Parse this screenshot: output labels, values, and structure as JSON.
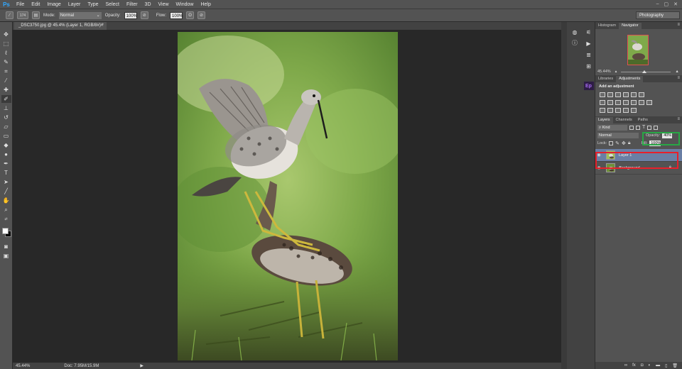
{
  "app": {
    "logo": "Ps",
    "menu": [
      "File",
      "Edit",
      "Image",
      "Layer",
      "Type",
      "Select",
      "Filter",
      "3D",
      "View",
      "Window",
      "Help"
    ],
    "window_controls": [
      "–",
      "▢",
      "✕"
    ]
  },
  "options": {
    "brush_size": "174",
    "mode_label": "Mode:",
    "mode_value": "Normal",
    "opacity_label": "Opacity:",
    "opacity_value": "100%",
    "flow_label": "Flow:",
    "flow_value": "100%",
    "workspace": "Photography"
  },
  "document": {
    "tab_title": "_DSC3750.jpg @ 45.4% (Layer 1, RGB/8#) *",
    "zoom": "45.44%",
    "doc_size": "Doc: 7.95M/15.9M"
  },
  "navigator": {
    "tabs": [
      "Histogram",
      "Navigator"
    ],
    "active_tab": "Navigator",
    "zoom": "45.44%"
  },
  "adjustments": {
    "tabs": [
      "Libraries",
      "Adjustments"
    ],
    "active_tab": "Adjustments",
    "heading": "Add an adjustment"
  },
  "layers": {
    "tabs": [
      "Layers",
      "Channels",
      "Paths"
    ],
    "active_tab": "Layers",
    "filter_kind": "Kind",
    "blend_mode": "Normal",
    "opacity_label": "Opacity:",
    "opacity_value": "40%",
    "lock_label": "Lock:",
    "fill_label": "Fill:",
    "fill_value": "100%",
    "items": [
      {
        "name": "Layer 1",
        "selected": true
      },
      {
        "name": "Background",
        "selected": false
      }
    ],
    "footer_icons": [
      "link-icon",
      "fx-icon",
      "mask-icon",
      "adjustment-icon",
      "group-icon",
      "new-layer-icon",
      "trash-icon"
    ]
  },
  "colors": {
    "highlight_red": "#e8202a",
    "highlight_green": "#28a745",
    "selected_layer": "#6a7fa5",
    "ps_blue": "#31a8ff"
  }
}
